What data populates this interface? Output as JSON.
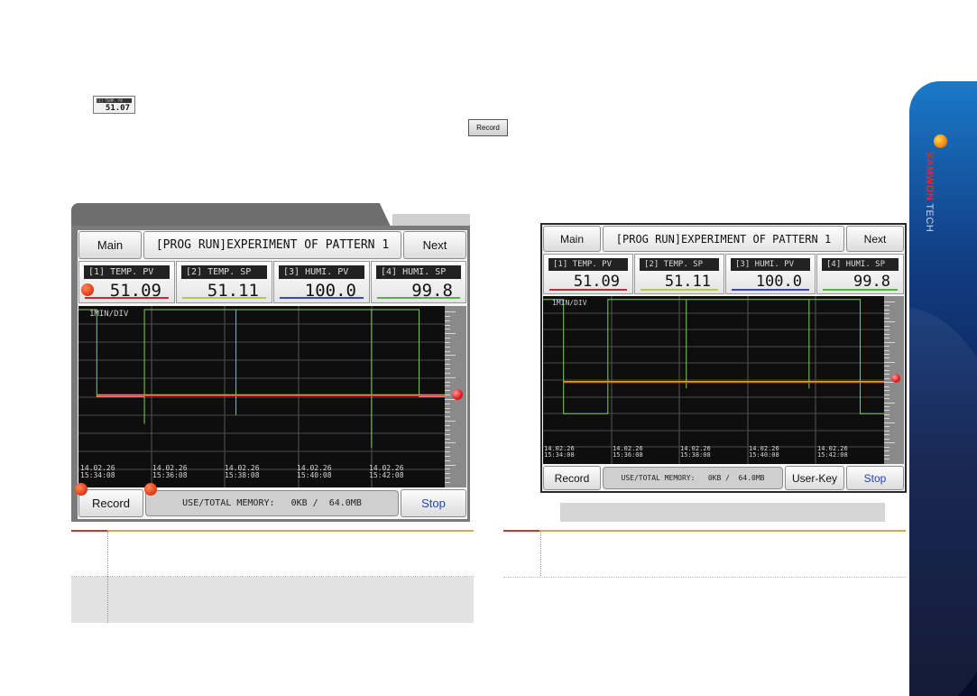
{
  "brand": {
    "name": "SAMWON",
    "suffix": "TECH"
  },
  "mini_pv": {
    "label": "[1] TEMP. PV",
    "value": "51.07"
  },
  "mini_record": {
    "label": "Record"
  },
  "screen_left": {
    "main_label": "Main",
    "title": "[PROG RUN]EXPERIMENT OF PATTERN 1",
    "next_label": "Next",
    "channels": [
      {
        "label": "[1] TEMP. PV",
        "value": "51.09",
        "color": "#c8283c"
      },
      {
        "label": "[2] TEMP. SP",
        "value": "51.11",
        "color": "#b8c848"
      },
      {
        "label": "[3] HUMI. PV",
        "value": "100.0",
        "color": "#3a48a8"
      },
      {
        "label": "[4] HUMI. SP",
        "value": "99.8",
        "color": "#58b048"
      }
    ],
    "div_label": "1MIN/DIV",
    "timestamps": [
      {
        "date": "14.02.26",
        "time": "15:34:08"
      },
      {
        "date": "14.02.26",
        "time": "15:36:08"
      },
      {
        "date": "14.02.26",
        "time": "15:38:08"
      },
      {
        "date": "14.02.26",
        "time": "15:40:08"
      },
      {
        "date": "14.02.26",
        "time": "15:42:08"
      }
    ],
    "record_label": "Record",
    "memory": "USE/TOTAL MEMORY:   0KB /  64.0MB",
    "stop_label": "Stop"
  },
  "screen_right": {
    "main_label": "Main",
    "title": "[PROG RUN]EXPERIMENT OF PATTERN 1",
    "next_label": "Next",
    "channels": [
      {
        "label": "[1] TEMP. PV",
        "value": "51.09",
        "color": "#c8283c"
      },
      {
        "label": "[2] TEMP. SP",
        "value": "51.11",
        "color": "#b8c848"
      },
      {
        "label": "[3] HUMI. PV",
        "value": "100.0",
        "color": "#3a48a8"
      },
      {
        "label": "[4] HUMI. SP",
        "value": "99.8",
        "color": "#58b048"
      }
    ],
    "div_label": "1MIN/DIV",
    "timestamps": [
      {
        "date": "14.02.26",
        "time": "15:34:08"
      },
      {
        "date": "14.02.26",
        "time": "15:36:08"
      },
      {
        "date": "14.02.26",
        "time": "15:38:08"
      },
      {
        "date": "14.02.26",
        "time": "15:40:08"
      },
      {
        "date": "14.02.26",
        "time": "15:42:08"
      }
    ],
    "record_label": "Record",
    "memory": "USE/TOTAL MEMORY:   0KB /  64.0MB",
    "userkey_label": "User-Key",
    "stop_label": "Stop"
  }
}
